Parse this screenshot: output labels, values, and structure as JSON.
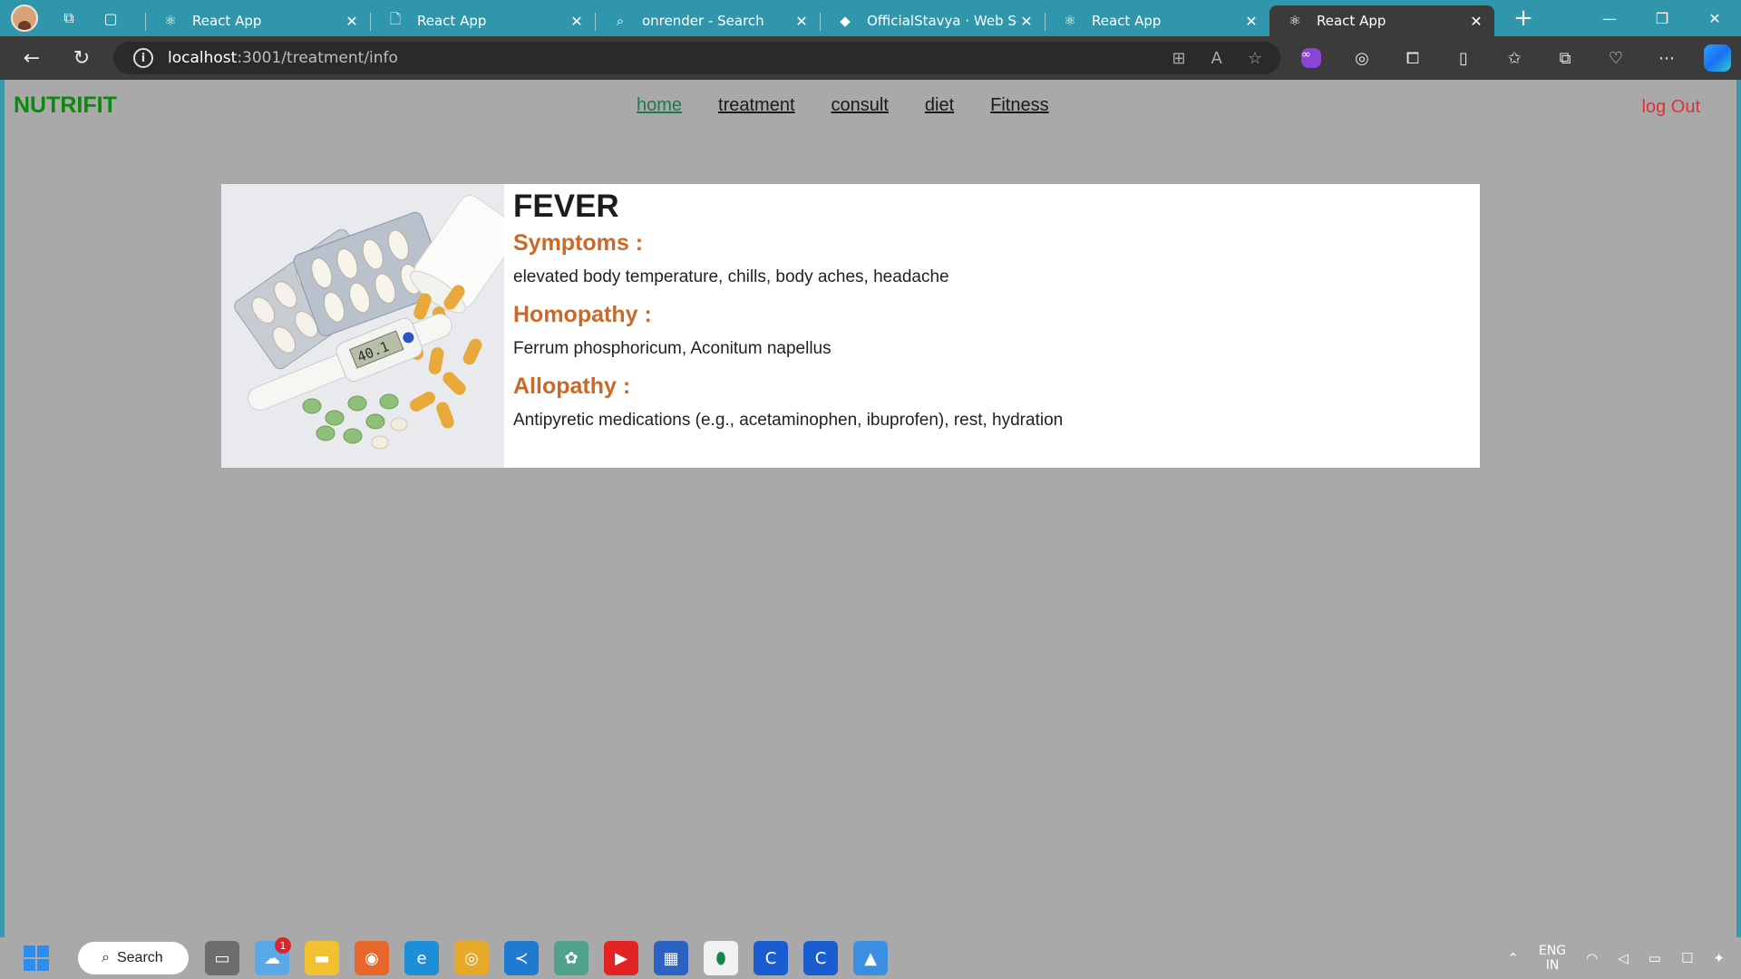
{
  "browser": {
    "tabs": [
      {
        "title": "React App",
        "icon": "react-icon",
        "active": false
      },
      {
        "title": "React App",
        "icon": "page-icon",
        "active": false
      },
      {
        "title": "onrender - Search",
        "icon": "search-icon",
        "active": false
      },
      {
        "title": "OfficialStavya · Web Serv",
        "icon": "render-icon",
        "active": false
      },
      {
        "title": "React App",
        "icon": "react-icon",
        "active": false
      },
      {
        "title": "React App",
        "icon": "react-icon",
        "active": true
      }
    ],
    "url_host": "localhost",
    "url_rest": ":3001/treatment/info"
  },
  "site": {
    "brand": "NUTRIFIT",
    "nav": [
      "home",
      "treatment",
      "consult",
      "diet",
      "Fitness"
    ],
    "logout": "log Out"
  },
  "treatment": {
    "name": "FEVER",
    "symptoms_heading": "Symptoms :",
    "symptoms": "elevated body temperature, chills, body aches, headache",
    "homeopathy_heading": "Homopathy :",
    "homeopathy": "Ferrum phosphoricum, Aconitum napellus",
    "allopathy_heading": "Allopathy :",
    "allopathy": "Antipyretic medications (e.g., acetaminophen, ibuprofen), rest, hydration",
    "thermometer_reading": "40.1"
  },
  "taskbar": {
    "search_label": "Search",
    "notification_count": "1",
    "lang_top": "ENG",
    "lang_bottom": "IN"
  },
  "colors": {
    "brand": "#0c8a0c",
    "section_heading": "#cb6a28",
    "logout": "#e0303a",
    "page_bg": "#a9a9a9"
  }
}
